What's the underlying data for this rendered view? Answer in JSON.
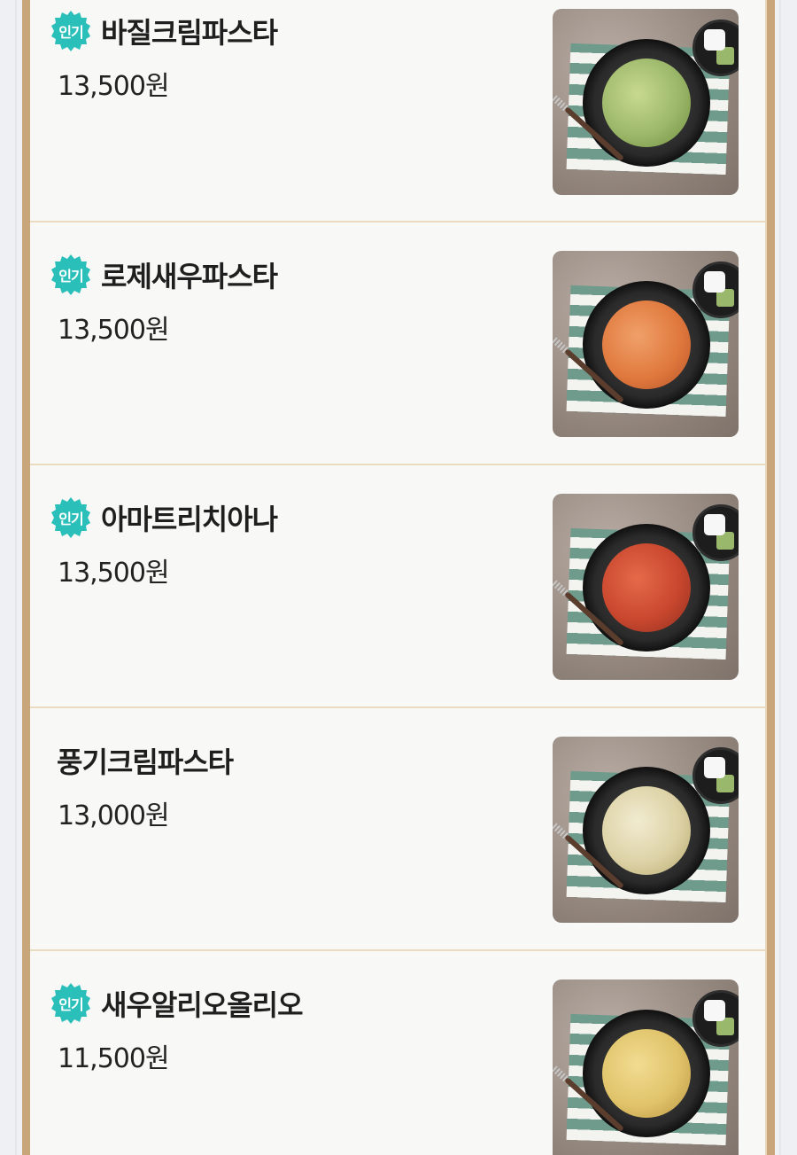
{
  "menu": {
    "badge_label": "인기",
    "items": [
      {
        "name": "바질크림파스타",
        "price": "13,500원",
        "popular": true,
        "food_color": "#9cb86a"
      },
      {
        "name": "로제새우파스타",
        "price": "13,500원",
        "popular": true,
        "food_color": "#e07a3e"
      },
      {
        "name": "아마트리치아나",
        "price": "13,500원",
        "popular": true,
        "food_color": "#c9472e"
      },
      {
        "name": "풍기크림파스타",
        "price": "13,000원",
        "popular": false,
        "food_color": "#ddd2a6"
      },
      {
        "name": "새우알리오올리오",
        "price": "11,500원",
        "popular": true,
        "food_color": "#e0c36a"
      }
    ]
  },
  "colors": {
    "badge": "#2bbfba",
    "frame": "#c9a57a",
    "divider": "#ecdcbf"
  }
}
